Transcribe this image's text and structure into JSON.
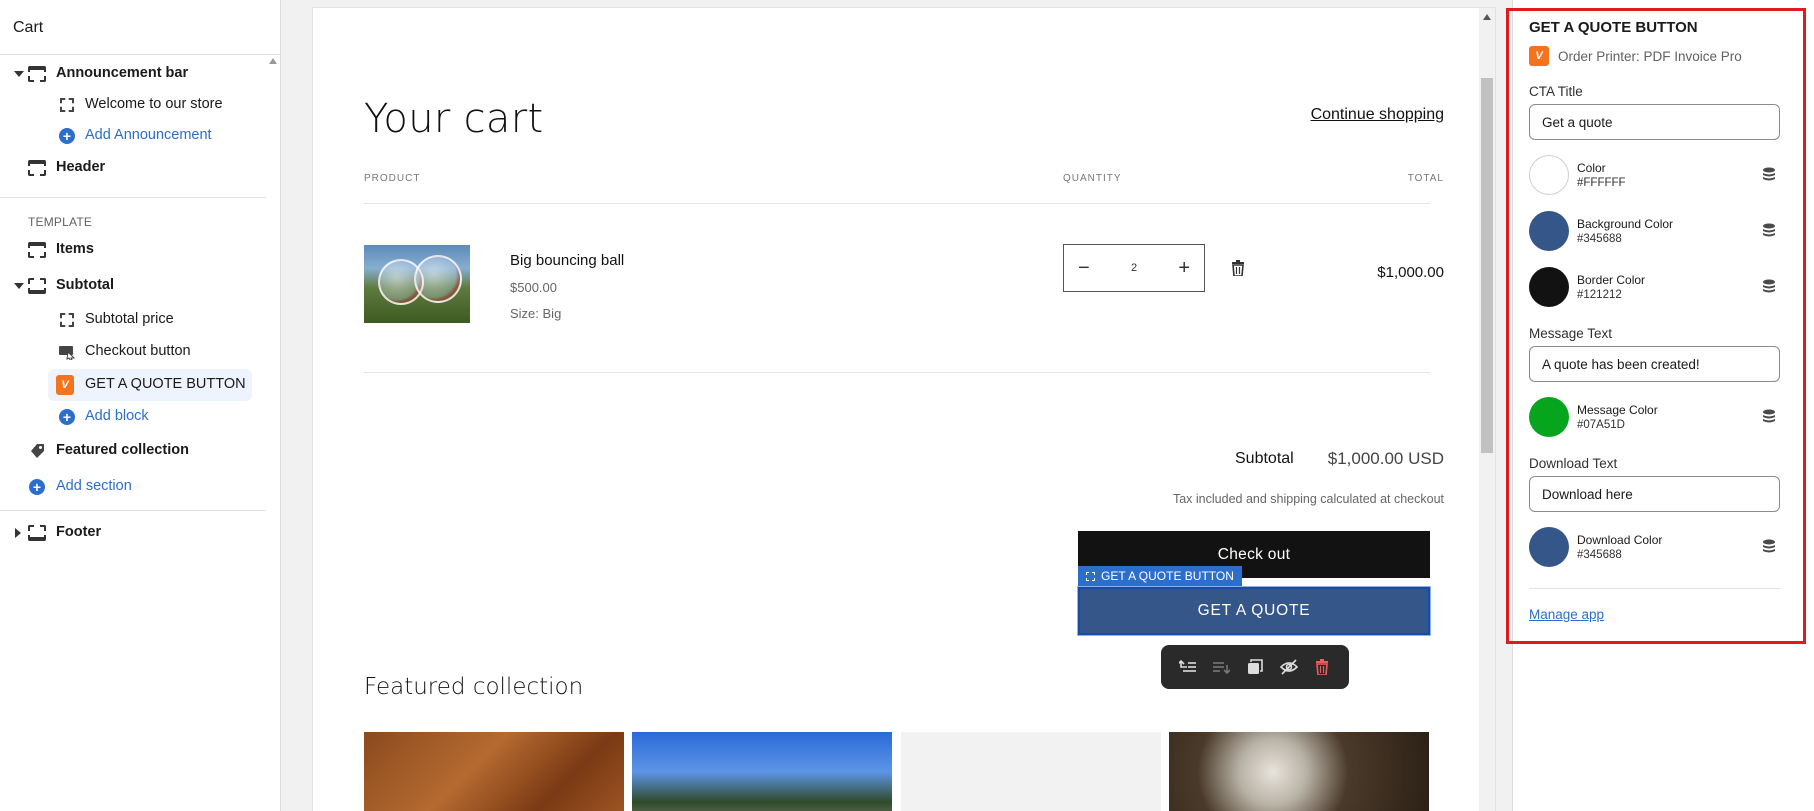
{
  "sidebar": {
    "title": "Cart",
    "items": [
      {
        "label": "Announcement bar"
      },
      {
        "label": "Welcome to our store"
      },
      {
        "label": "Add Announcement"
      },
      {
        "label": "Header"
      },
      {
        "label": "TEMPLATE"
      },
      {
        "label": "Items"
      },
      {
        "label": "Subtotal"
      },
      {
        "label": "Subtotal price"
      },
      {
        "label": "Checkout button"
      },
      {
        "label": "GET A QUOTE BUTTON"
      },
      {
        "label": "Add block"
      },
      {
        "label": "Featured collection"
      },
      {
        "label": "Add section"
      },
      {
        "label": "Footer"
      }
    ],
    "app_badge": "V"
  },
  "preview": {
    "title": "Your cart",
    "continue_link": "Continue shopping",
    "headers": {
      "product": "PRODUCT",
      "quantity": "QUANTITY",
      "total": "TOTAL"
    },
    "product": {
      "name": "Big bouncing ball",
      "price": "$500.00",
      "size": "Size: Big",
      "quantity": "2",
      "line_total": "$1,000.00"
    },
    "subtotal_label": "Subtotal",
    "subtotal_value": "$1,000.00 USD",
    "tax_note": "Tax included and shipping calculated at checkout",
    "checkout_label": "Check out",
    "quote_tag": "GET A QUOTE BUTTON",
    "quote_label": "GET A QUOTE",
    "featured_title": "Featured collection"
  },
  "panel": {
    "title": "GET A QUOTE BUTTON",
    "app_name": "Order Printer: PDF Invoice Pro",
    "cta_title_label": "CTA Title",
    "cta_title_value": "Get a quote",
    "colors": [
      {
        "name": "Color",
        "hex": "#FFFFFF"
      },
      {
        "name": "Background Color",
        "hex": "#345688"
      },
      {
        "name": "Border Color",
        "hex": "#121212"
      }
    ],
    "message_text_label": "Message Text",
    "message_text_value": "A quote has been created!",
    "message_color": {
      "name": "Message Color",
      "hex": "#07A51D"
    },
    "download_text_label": "Download Text",
    "download_text_value": "Download here",
    "download_color": {
      "name": "Download Color",
      "hex": "#345688"
    },
    "manage_link": "Manage app"
  },
  "colors": {
    "accent": "#2c6ecb",
    "highlight": "#e01b1b",
    "quote_bg": "#345688",
    "app_badge": "#f4731c"
  }
}
